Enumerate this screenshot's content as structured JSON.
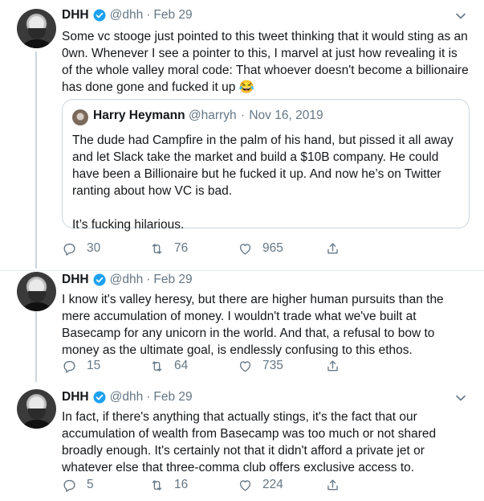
{
  "tweets": [
    {
      "name": "DHH",
      "handle": "@dhh",
      "separator": "·",
      "date": "Feb 29",
      "text": "Some vc stooge just pointed to this tweet thinking that it would sting as an 0wn. Whenever I see a pointer to this, I marvel at just how revealing it is of the whole valley moral code: That whoever doesn't become a billionaire has done gone and fucked it up 😂",
      "quote": {
        "name": "Harry Heymann",
        "handle": "@harryh",
        "separator": "·",
        "date": "Nov 16, 2019",
        "text": "The dude had Campfire in the palm of his hand, but pissed it all away and let Slack take the market and build a $10B company. He could have been a Billionaire but he fucked it up. And now he’s on Twitter ranting about how VC is bad.",
        "text2": "It’s fucking hilarious."
      },
      "replies": "30",
      "retweets": "76",
      "likes": "965"
    },
    {
      "name": "DHH",
      "handle": "@dhh",
      "separator": "·",
      "date": "Feb 29",
      "text": "I know it's valley heresy, but there are higher human pursuits than the mere accumulation of money. I wouldn't trade what we've built at Basecamp for any unicorn in the world. And that, a refusal to bow to money as the ultimate goal, is endlessly confusing to this ethos.",
      "replies": "15",
      "retweets": "64",
      "likes": "735"
    },
    {
      "name": "DHH",
      "handle": "@dhh",
      "separator": "·",
      "date": "Feb 29",
      "text": "In fact, if there's anything that actually stings, it's the fact that our accumulation of wealth from Basecamp was too much or not shared broadly enough. It's certainly not that it didn't afford a private jet or whatever else that three-comma club offers exclusive access to.",
      "replies": "5",
      "retweets": "16",
      "likes": "224"
    }
  ],
  "colors": {
    "text": "#14171a",
    "secondary": "#657786",
    "verified": "#1da1f2",
    "border": "#ccd6dd"
  },
  "icons": [
    "verified-badge-icon",
    "chevron-down-icon",
    "reply-icon",
    "retweet-icon",
    "like-icon",
    "share-icon"
  ]
}
